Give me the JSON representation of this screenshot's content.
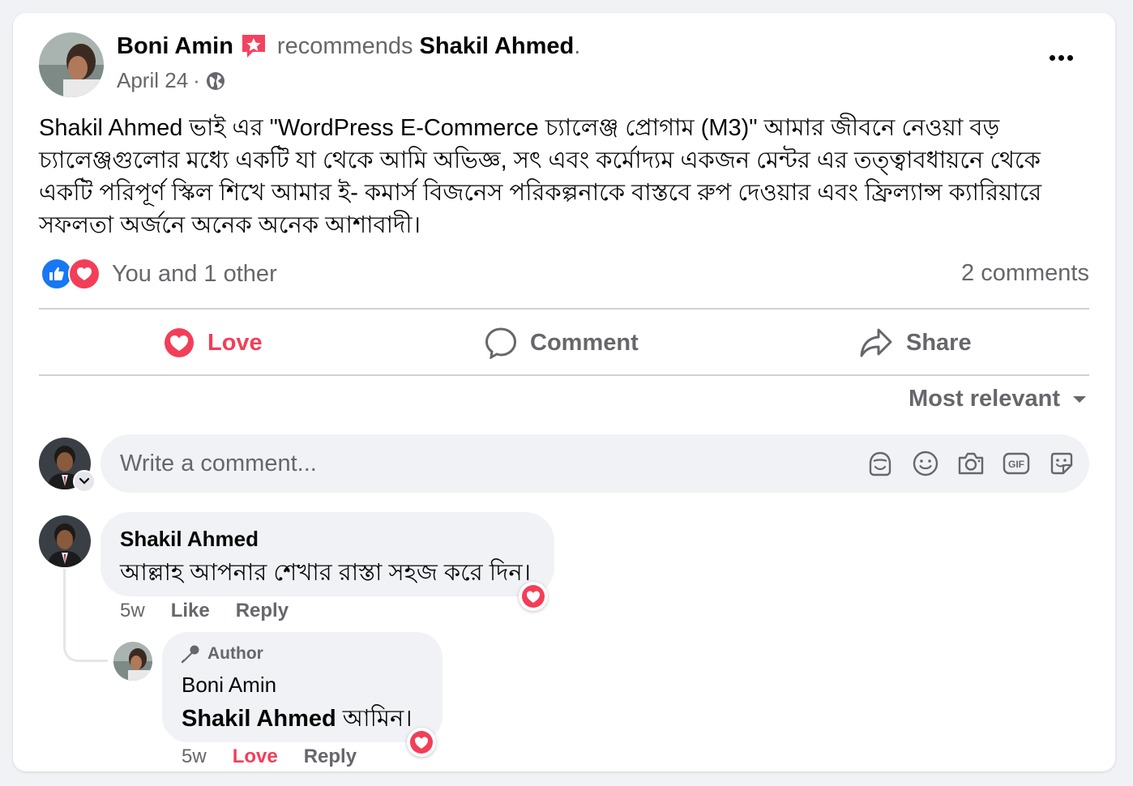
{
  "post": {
    "author": "Boni Amin",
    "verb": "recommends",
    "target": "Shakil Ahmed",
    "date": "April 24",
    "date_separator": "·",
    "body": "Shakil Ahmed ভাই এর \"WordPress E-Commerce চ্যালেঞ্জ প্রোগাম (M3)\" আমার জীবনে নেওয়া বড় চ্যালেঞ্জগুলোর মধ্যে একটি যা থেকে আমি অভিজ্ঞ, সৎ এবং কর্মোদ্যম একজন মেন্টর এর তত্ত্বাবধায়নে থেকে একটি পরিপূর্ণ স্কিল শিখে আমার ই- কমার্স বিজনেস পরিকল্পনাকে বাস্তবে রুপ দেওয়ার এবং ফ্রিল্যান্স ক্যারিয়ারে সফলতা অর্জনে অনেক অনেক আশাবাদী।",
    "reactions_text": "You and 1 other",
    "comments_count": "2 comments"
  },
  "actions": {
    "love": "Love",
    "comment": "Comment",
    "share": "Share"
  },
  "sort_label": "Most relevant",
  "comment_input": {
    "placeholder": "Write a comment..."
  },
  "comments": [
    {
      "name": "Shakil Ahmed",
      "text": "আল্লাহ আপনার শেখার রাস্তা সহজ করে দিন।",
      "time": "5w",
      "like": "Like",
      "reply": "Reply"
    }
  ],
  "reply": {
    "badge": "Author",
    "name": "Boni Amin",
    "mention": "Shakil Ahmed",
    "text": " আমিন।",
    "time": "5w",
    "love": "Love",
    "reply": "Reply"
  },
  "colors": {
    "love": "#f33e58",
    "like_blue": "#1877f2",
    "muted": "#65676b"
  }
}
